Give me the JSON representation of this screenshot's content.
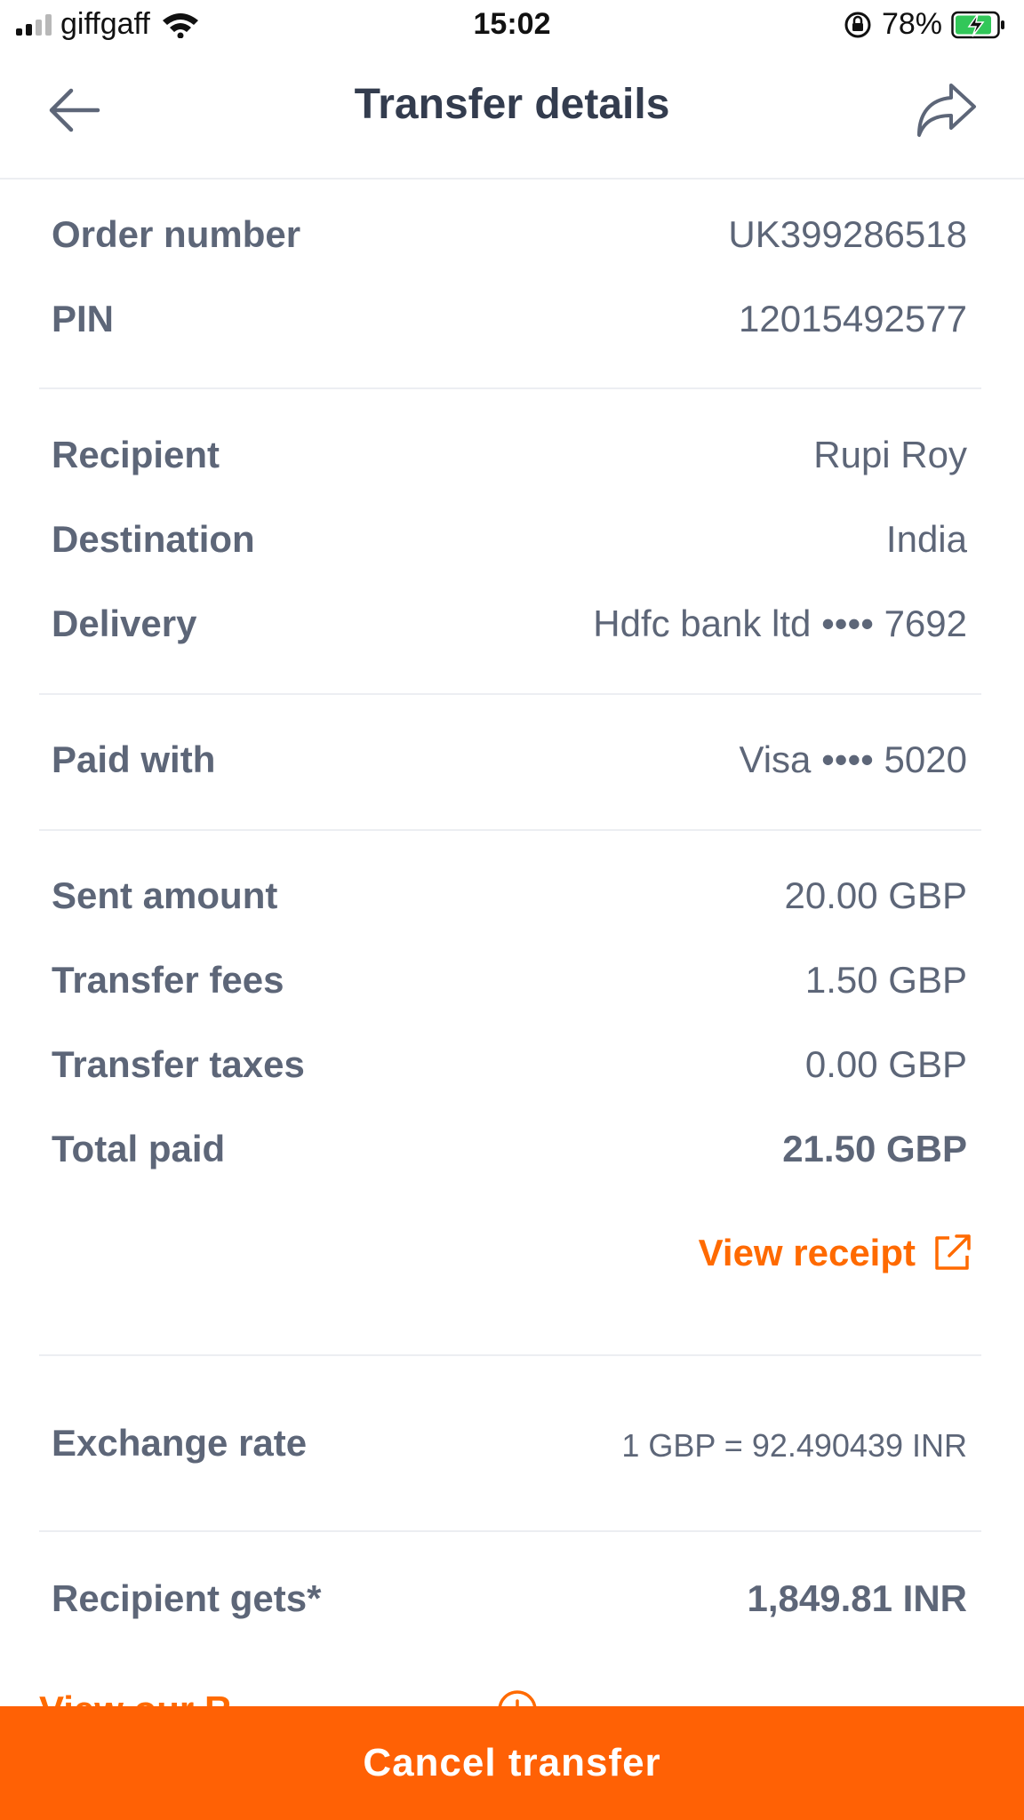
{
  "status_bar": {
    "carrier": "giffgaff",
    "time": "15:02",
    "battery": "78%"
  },
  "header": {
    "title": "Transfer details",
    "back_icon": "arrow-left-icon",
    "share_icon": "share-forward-icon"
  },
  "details": {
    "order_number_label": "Order number",
    "order_number_value": "UK399286518",
    "pin_label": "PIN",
    "pin_value": "12015492577",
    "recipient_label": "Recipient",
    "recipient_value": "Rupi Roy",
    "destination_label": "Destination",
    "destination_value": "India",
    "delivery_label": "Delivery",
    "delivery_value": "Hdfc bank ltd •••• 7692",
    "paid_with_label": "Paid with",
    "paid_with_value": "Visa •••• 5020",
    "sent_amount_label": "Sent amount",
    "sent_amount_value": "20.00 GBP",
    "transfer_fees_label": "Transfer fees",
    "transfer_fees_value": "1.50 GBP",
    "transfer_taxes_label": "Transfer taxes",
    "transfer_taxes_value": "0.00 GBP",
    "total_paid_label": "Total paid",
    "total_paid_value": "21.50 GBP",
    "view_receipt": "View receipt",
    "exchange_rate_label": "Exchange rate",
    "exchange_rate_value": "1 GBP = 92.490439 INR",
    "recipient_gets_label": "Recipient gets*",
    "recipient_gets_value": "1,849.81 INR"
  },
  "promo_partial": "View our R",
  "cancel_button": "Cancel transfer",
  "colors": {
    "accent": "#ff6105",
    "text": "#5d6678",
    "title": "#333c4e",
    "divider": "#eceef2"
  }
}
